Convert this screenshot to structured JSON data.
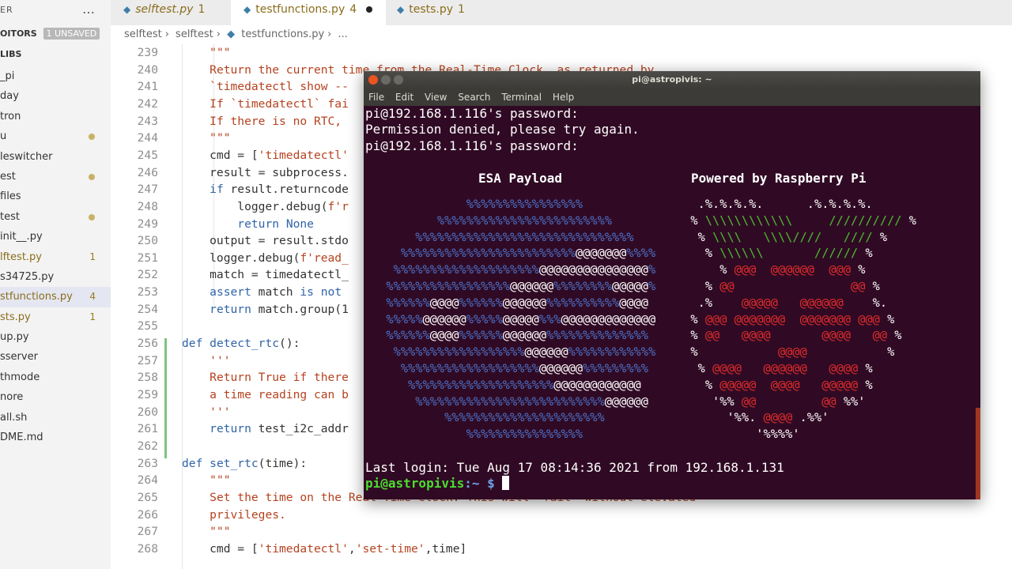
{
  "sidebar": {
    "explorer_label": "ER",
    "more_icon": "…",
    "open_editors_label": "OITORS",
    "unsaved_badge": "1 UNSAVED",
    "libs_label": "LIBS",
    "files": [
      {
        "name": "_pi",
        "badge": ""
      },
      {
        "name": "day",
        "badge": ""
      },
      {
        "name": "tron",
        "badge": ""
      },
      {
        "name": "u",
        "badge": "dot"
      },
      {
        "name": "leswitcher",
        "badge": ""
      },
      {
        "name": "est",
        "badge": "dot"
      },
      {
        "name": "files",
        "badge": ""
      },
      {
        "name": "test",
        "badge": "dot"
      },
      {
        "name": "init__.py",
        "badge": ""
      },
      {
        "name": "lftest.py",
        "badge": "1"
      },
      {
        "name": "s34725.py",
        "badge": ""
      },
      {
        "name": "stfunctions.py",
        "badge": "4"
      },
      {
        "name": "sts.py",
        "badge": "1"
      },
      {
        "name": "up.py",
        "badge": ""
      },
      {
        "name": "sserver",
        "badge": ""
      },
      {
        "name": "thmode",
        "badge": ""
      },
      {
        "name": "nore",
        "badge": ""
      },
      {
        "name": "all.sh",
        "badge": ""
      },
      {
        "name": "DME.md",
        "badge": ""
      }
    ]
  },
  "tabs": [
    {
      "label": "selftest.py",
      "count": "1",
      "active": false
    },
    {
      "label": "testfunctions.py",
      "count": "4",
      "active": true
    },
    {
      "label": "tests.py",
      "count": "1",
      "active": false
    }
  ],
  "breadcrumb": [
    "selftest",
    "selftest",
    "testfunctions.py",
    "..."
  ],
  "code_lines": [
    {
      "n": "239",
      "html": "    <span class='str'>\"\"\"</span>"
    },
    {
      "n": "240",
      "html": "    <span class='str'>Return the current time from the Real-Time Clock, as returned by</span>"
    },
    {
      "n": "241",
      "html": "    <span class='str'>`timedatectl show --</span>"
    },
    {
      "n": "242",
      "html": "    <span class='str'>If `timedatectl` fai</span>"
    },
    {
      "n": "243",
      "html": "    <span class='str'>If there is no RTC, </span>"
    },
    {
      "n": "244",
      "html": "    <span class='str'>\"\"\"</span>"
    },
    {
      "n": "245",
      "html": "    cmd = [<span class='str'>'timedatectl'</span>"
    },
    {
      "n": "246",
      "html": "    result = subprocess."
    },
    {
      "n": "247",
      "html": "    <span class='kw'>if</span> result.returncode"
    },
    {
      "n": "248",
      "html": "        logger.debug(<span class='str'>f'r</span>"
    },
    {
      "n": "249",
      "html": "        <span class='kw'>return</span> <span class='kw'>None</span>"
    },
    {
      "n": "250",
      "html": "    output = result.stdo"
    },
    {
      "n": "251",
      "html": "    logger.debug(<span class='str'>f'read_</span>"
    },
    {
      "n": "252",
      "html": "    match = timedatectl_"
    },
    {
      "n": "253",
      "html": "    <span class='kw'>assert</span> match <span class='kw'>is not</span>"
    },
    {
      "n": "254",
      "html": "    <span class='kw'>return</span> match.group(1"
    },
    {
      "n": "255",
      "html": ""
    },
    {
      "n": "256",
      "html": "<span class='kw'>def</span> <span class='fn'>detect_rtc</span>():"
    },
    {
      "n": "257",
      "html": "    <span class='str'>'''</span>"
    },
    {
      "n": "258",
      "html": "    <span class='str'>Return True if there</span>"
    },
    {
      "n": "259",
      "html": "    <span class='str'>a time reading can b</span>"
    },
    {
      "n": "260",
      "html": "    <span class='str'>'''</span>"
    },
    {
      "n": "261",
      "html": "    <span class='kw'>return</span> test_i2c_addr"
    },
    {
      "n": "262",
      "html": ""
    },
    {
      "n": "263",
      "html": "<span class='kw'>def</span> <span class='fn'>set_rtc</span>(time):"
    },
    {
      "n": "264",
      "html": "    <span class='str'>\"\"\"</span>"
    },
    {
      "n": "265",
      "html": "    <span class='str'>Set the time on the Real-Time Clock. This will *fail* without elevated</span>"
    },
    {
      "n": "266",
      "html": "    <span class='str'>privileges.</span>"
    },
    {
      "n": "267",
      "html": "    <span class='str'>\"\"\"</span>"
    },
    {
      "n": "268",
      "html": "    cmd = [<span class='str'>'timedatectl'</span>,<span class='str'>'set-time'</span>,time]"
    }
  ],
  "terminal": {
    "title": "pi@astropivis: ~",
    "menu": [
      "File",
      "Edit",
      "View",
      "Search",
      "Terminal",
      "Help"
    ],
    "lines": [
      "pi@192.168.1.116's password:",
      "Permission denied, please try again.",
      "pi@192.168.1.116's password:"
    ],
    "esa_title": "ESA Payload",
    "rpi_title": "Powered by Raspberry Pi",
    "last_login": "Last login: Tue Aug 17 08:14:36 2021 from 192.168.1.131",
    "prompt_user": "pi@astropivis",
    "prompt_path": ":~ $ "
  },
  "colors": {
    "terminal_bg": "#300a24",
    "prompt_green": "#4bdd2f",
    "esa_blue": "#4d71c8",
    "rpi_red": "#e02c2c",
    "rpi_green": "#4bbd2f"
  }
}
